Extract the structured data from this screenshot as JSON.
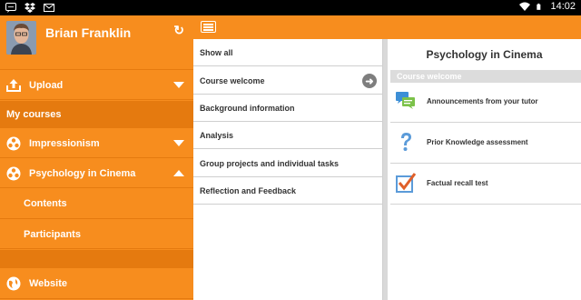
{
  "status": {
    "time": "14:02"
  },
  "drawer": {
    "user_name": "Brian Franklin",
    "items": [
      {
        "label": "Upload"
      },
      {
        "label": "My courses"
      },
      {
        "label": "Impressionism"
      },
      {
        "label": "Psychology in Cinema"
      },
      {
        "label": "Contents"
      },
      {
        "label": "Participants"
      },
      {
        "label": "Website"
      }
    ]
  },
  "course_menu": {
    "items": [
      {
        "label": "Show all"
      },
      {
        "label": "Course welcome"
      },
      {
        "label": "Background information"
      },
      {
        "label": "Analysis"
      },
      {
        "label": "Group projects and individual tasks"
      },
      {
        "label": "Reflection and Feedback"
      }
    ]
  },
  "detail": {
    "title": "Psychology in Cinema",
    "section": "Course welcome",
    "items": [
      {
        "label": "Announcements from your tutor",
        "icon": "chat-bubbles-icon"
      },
      {
        "label": "Prior Knowledge assessment",
        "icon": "question-mark-icon"
      },
      {
        "label": "Factual recall test",
        "icon": "checkbox-icon"
      }
    ]
  },
  "colors": {
    "accent": "#f78d1e",
    "accent_dark": "#e57a0f"
  }
}
